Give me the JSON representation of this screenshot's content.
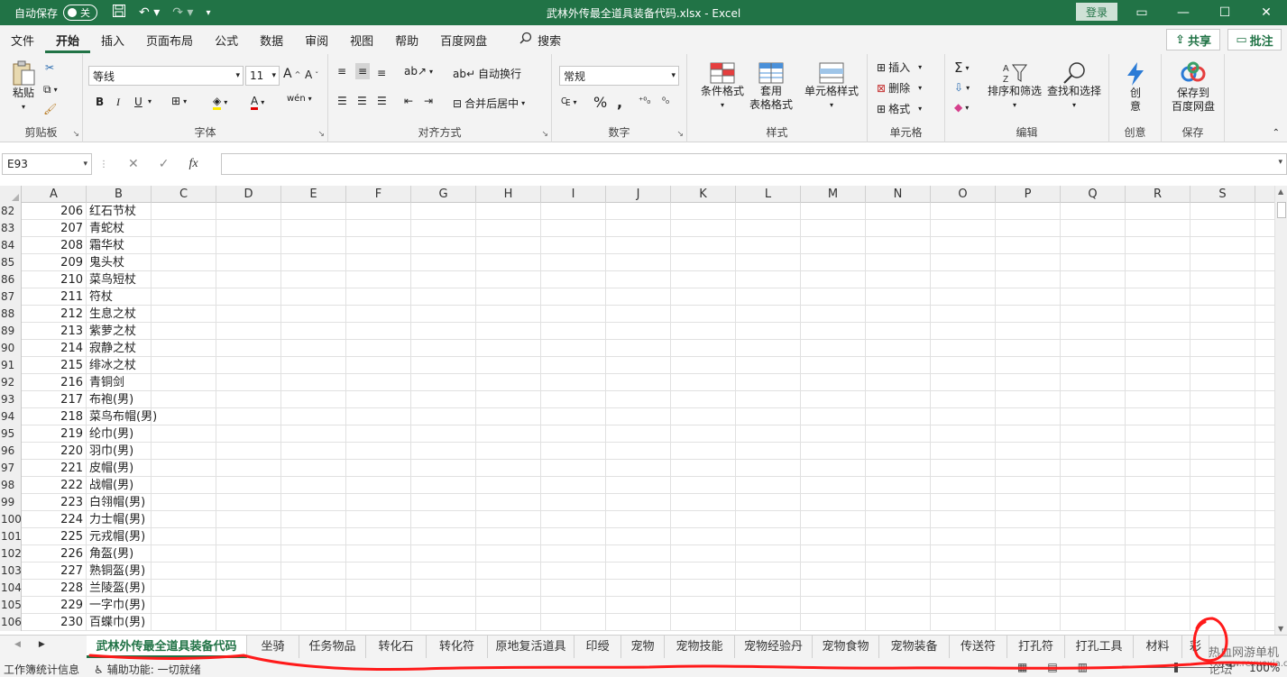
{
  "titlebar": {
    "autosave_label": "自动保存",
    "autosave_state": "关",
    "title": "武林外传最全道具装备代码.xlsx  -  Excel",
    "login": "登录"
  },
  "menu": {
    "tabs": [
      "文件",
      "开始",
      "插入",
      "页面布局",
      "公式",
      "数据",
      "审阅",
      "视图",
      "帮助",
      "百度网盘"
    ],
    "search": "搜索",
    "share": "共享",
    "comment": "批注"
  },
  "ribbon": {
    "clipboard": {
      "paste": "粘贴",
      "label": "剪贴板"
    },
    "font": {
      "name": "等线",
      "size": "11",
      "label": "字体",
      "bold": "B",
      "italic": "I",
      "underline": "U"
    },
    "align": {
      "wrap": "自动换行",
      "merge": "合并后居中",
      "label": "对齐方式"
    },
    "number": {
      "format": "常规",
      "label": "数字"
    },
    "styles": {
      "cond": "条件格式",
      "table1": "套用",
      "table2": "表格格式",
      "cellstyle": "单元格样式",
      "label": "样式"
    },
    "cells": {
      "insert": "插入",
      "delete": "删除",
      "format": "格式",
      "label": "单元格"
    },
    "editing": {
      "sort": "排序和筛选",
      "find": "查找和选择",
      "label": "编辑"
    },
    "idea": {
      "btn1": "创",
      "btn2": "意",
      "label": "创意"
    },
    "save": {
      "btn1": "保存到",
      "btn2": "百度网盘",
      "label": "保存"
    }
  },
  "formula_bar": {
    "name_box": "E93",
    "value": ""
  },
  "columns": [
    "A",
    "B",
    "C",
    "D",
    "E",
    "F",
    "G",
    "H",
    "I",
    "J",
    "K",
    "L",
    "M",
    "N",
    "O",
    "P",
    "Q",
    "R",
    "S"
  ],
  "rows": [
    {
      "n": "82",
      "a": "206",
      "b": "红石节杖"
    },
    {
      "n": "83",
      "a": "207",
      "b": "青蛇杖"
    },
    {
      "n": "84",
      "a": "208",
      "b": "霜华杖"
    },
    {
      "n": "85",
      "a": "209",
      "b": "鬼头杖"
    },
    {
      "n": "86",
      "a": "210",
      "b": "菜鸟短杖"
    },
    {
      "n": "87",
      "a": "211",
      "b": "符杖"
    },
    {
      "n": "88",
      "a": "212",
      "b": "生息之杖"
    },
    {
      "n": "89",
      "a": "213",
      "b": "紫萝之杖"
    },
    {
      "n": "90",
      "a": "214",
      "b": "寂静之杖"
    },
    {
      "n": "91",
      "a": "215",
      "b": "绯冰之杖"
    },
    {
      "n": "92",
      "a": "216",
      "b": "青铜剑"
    },
    {
      "n": "93",
      "a": "217",
      "b": "布袍(男)"
    },
    {
      "n": "94",
      "a": "218",
      "b": "菜鸟布帽(男)"
    },
    {
      "n": "95",
      "a": "219",
      "b": "纶巾(男)"
    },
    {
      "n": "96",
      "a": "220",
      "b": "羽巾(男)"
    },
    {
      "n": "97",
      "a": "221",
      "b": "皮帽(男)"
    },
    {
      "n": "98",
      "a": "222",
      "b": "战帽(男)"
    },
    {
      "n": "99",
      "a": "223",
      "b": "白翎帽(男)"
    },
    {
      "n": "100",
      "a": "224",
      "b": "力士帽(男)"
    },
    {
      "n": "101",
      "a": "225",
      "b": "元戎帽(男)"
    },
    {
      "n": "102",
      "a": "226",
      "b": "角盔(男)"
    },
    {
      "n": "103",
      "a": "227",
      "b": "熟铜盔(男)"
    },
    {
      "n": "104",
      "a": "228",
      "b": "兰陵盔(男)"
    },
    {
      "n": "105",
      "a": "229",
      "b": "一字巾(男)"
    },
    {
      "n": "106",
      "a": "230",
      "b": "百蝶巾(男)"
    }
  ],
  "sheets": [
    "武林外传最全道具装备代码",
    "坐骑",
    "任务物品",
    "转化石",
    "转化符",
    "原地复活道具",
    "印绶",
    "宠物",
    "宠物技能",
    "宠物经验丹",
    "宠物食物",
    "宠物装备",
    "传送符",
    "打孔符",
    "打孔工具",
    "材料",
    "彩"
  ],
  "status": {
    "left": "工作簿统计信息",
    "accessibility": "辅助功能: 一切就绪",
    "zoom": "100%"
  },
  "watermark": {
    "line1": "热血网游单机论坛",
    "line2": "www.rexuexia.com"
  },
  "colors": {
    "accent": "#217346",
    "annotation": "#ff1a1a"
  }
}
